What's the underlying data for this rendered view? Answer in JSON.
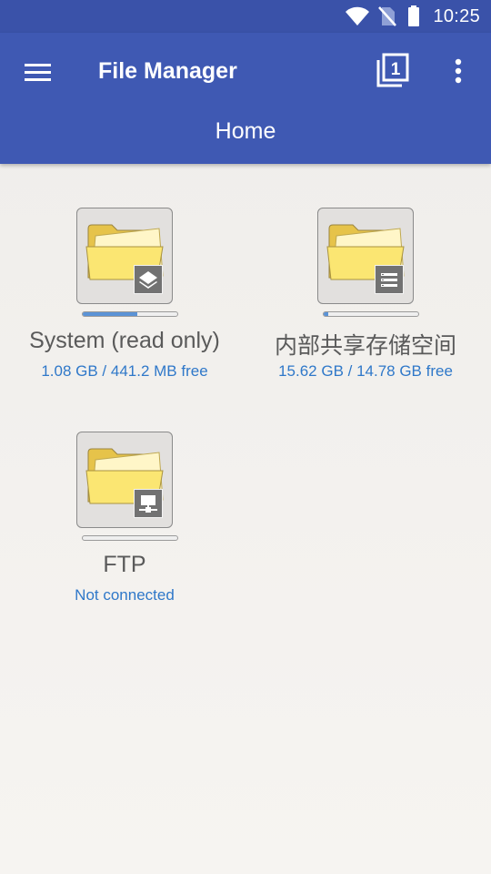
{
  "status_bar": {
    "time": "10:25",
    "icons": [
      "wifi-icon",
      "no-sim-icon",
      "battery-icon"
    ]
  },
  "app_bar": {
    "title": "File Manager",
    "menu_icon": "hamburger-menu-icon",
    "tabs_icon": "tab-count-icon",
    "tab_count": "1",
    "overflow_icon": "more-vert-icon"
  },
  "tabs": [
    {
      "label": "Home"
    }
  ],
  "volumes": [
    {
      "name": "System (read only)",
      "info": "1.08 GB / 441.2 MB free",
      "badge_icon": "layers-icon",
      "usage_fraction": 0.58
    },
    {
      "name": "内部共享存储空间",
      "info": "15.62 GB / 14.78 GB free",
      "badge_icon": "storage-icon",
      "usage_fraction": 0.05
    },
    {
      "name": "FTP",
      "info": "Not connected",
      "badge_icon": "network-icon",
      "usage_fraction": 0
    }
  ],
  "colors": {
    "app_bar": "#3f59b3",
    "status_bar": "#3a52a9",
    "info_text": "#2f78c9",
    "usage_fill": "#5b93d6"
  }
}
